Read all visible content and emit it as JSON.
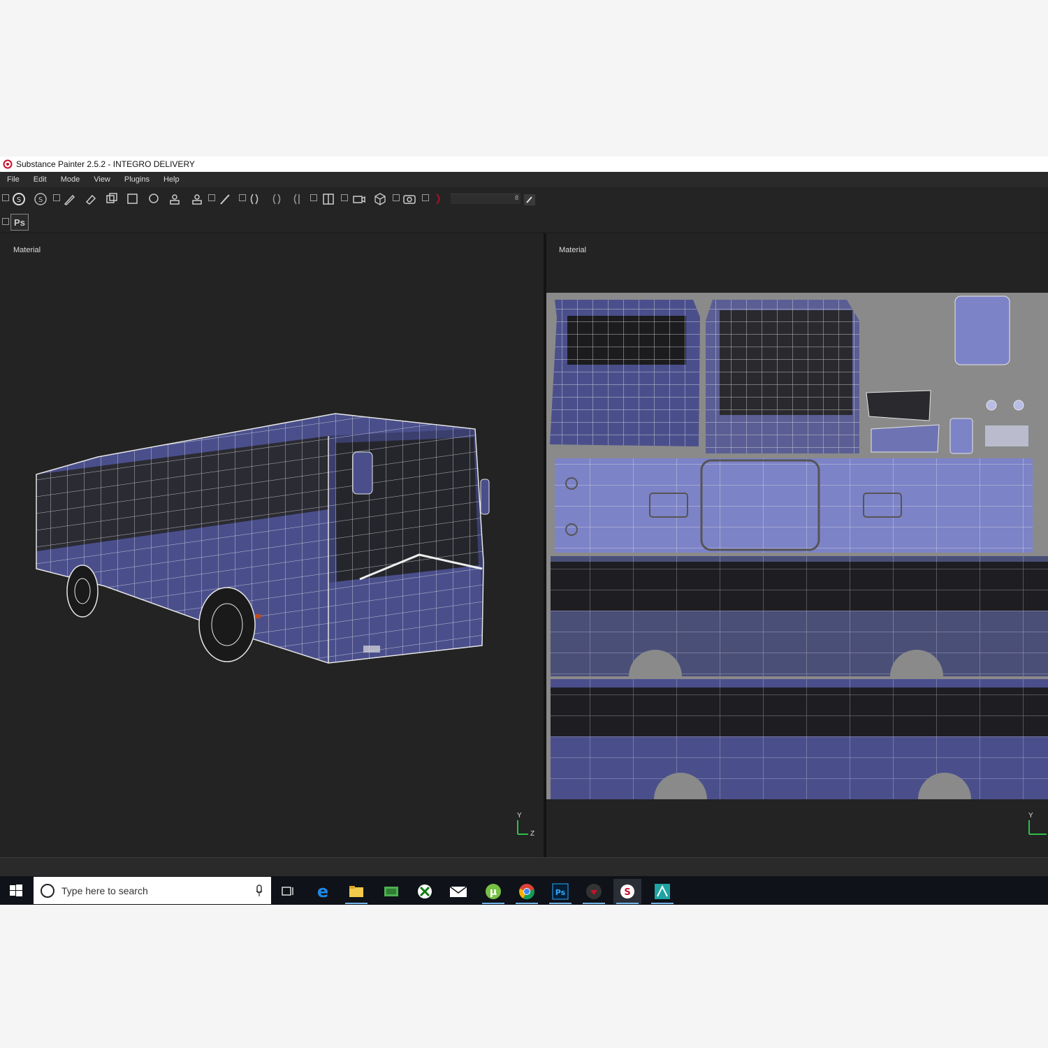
{
  "window": {
    "title": "Substance Painter 2.5.2 - INTEGRO DELIVERY"
  },
  "menu": [
    "File",
    "Edit",
    "Mode",
    "View",
    "Plugins",
    "Help"
  ],
  "toolbar": {
    "brush_size_value": "8",
    "ps_button_label": "Ps"
  },
  "viewport_3d": {
    "label": "Material",
    "axis_y": "Y",
    "axis_z": "Z"
  },
  "viewport_2d": {
    "label": "Material",
    "axis_y": "Y"
  },
  "taskbar": {
    "search_placeholder": "Type here to search",
    "apps": [
      "task-view",
      "edge",
      "file-explorer",
      "photos",
      "xbox",
      "mail",
      "utorrent",
      "chrome",
      "photoshop",
      "media-player",
      "substance-painter",
      "maya"
    ]
  },
  "colors": {
    "model_blue": "#4a4f8c",
    "uv_background": "#8a8a8a",
    "uv_blue": "#7d83c7",
    "wire": "#e6e6e6"
  }
}
